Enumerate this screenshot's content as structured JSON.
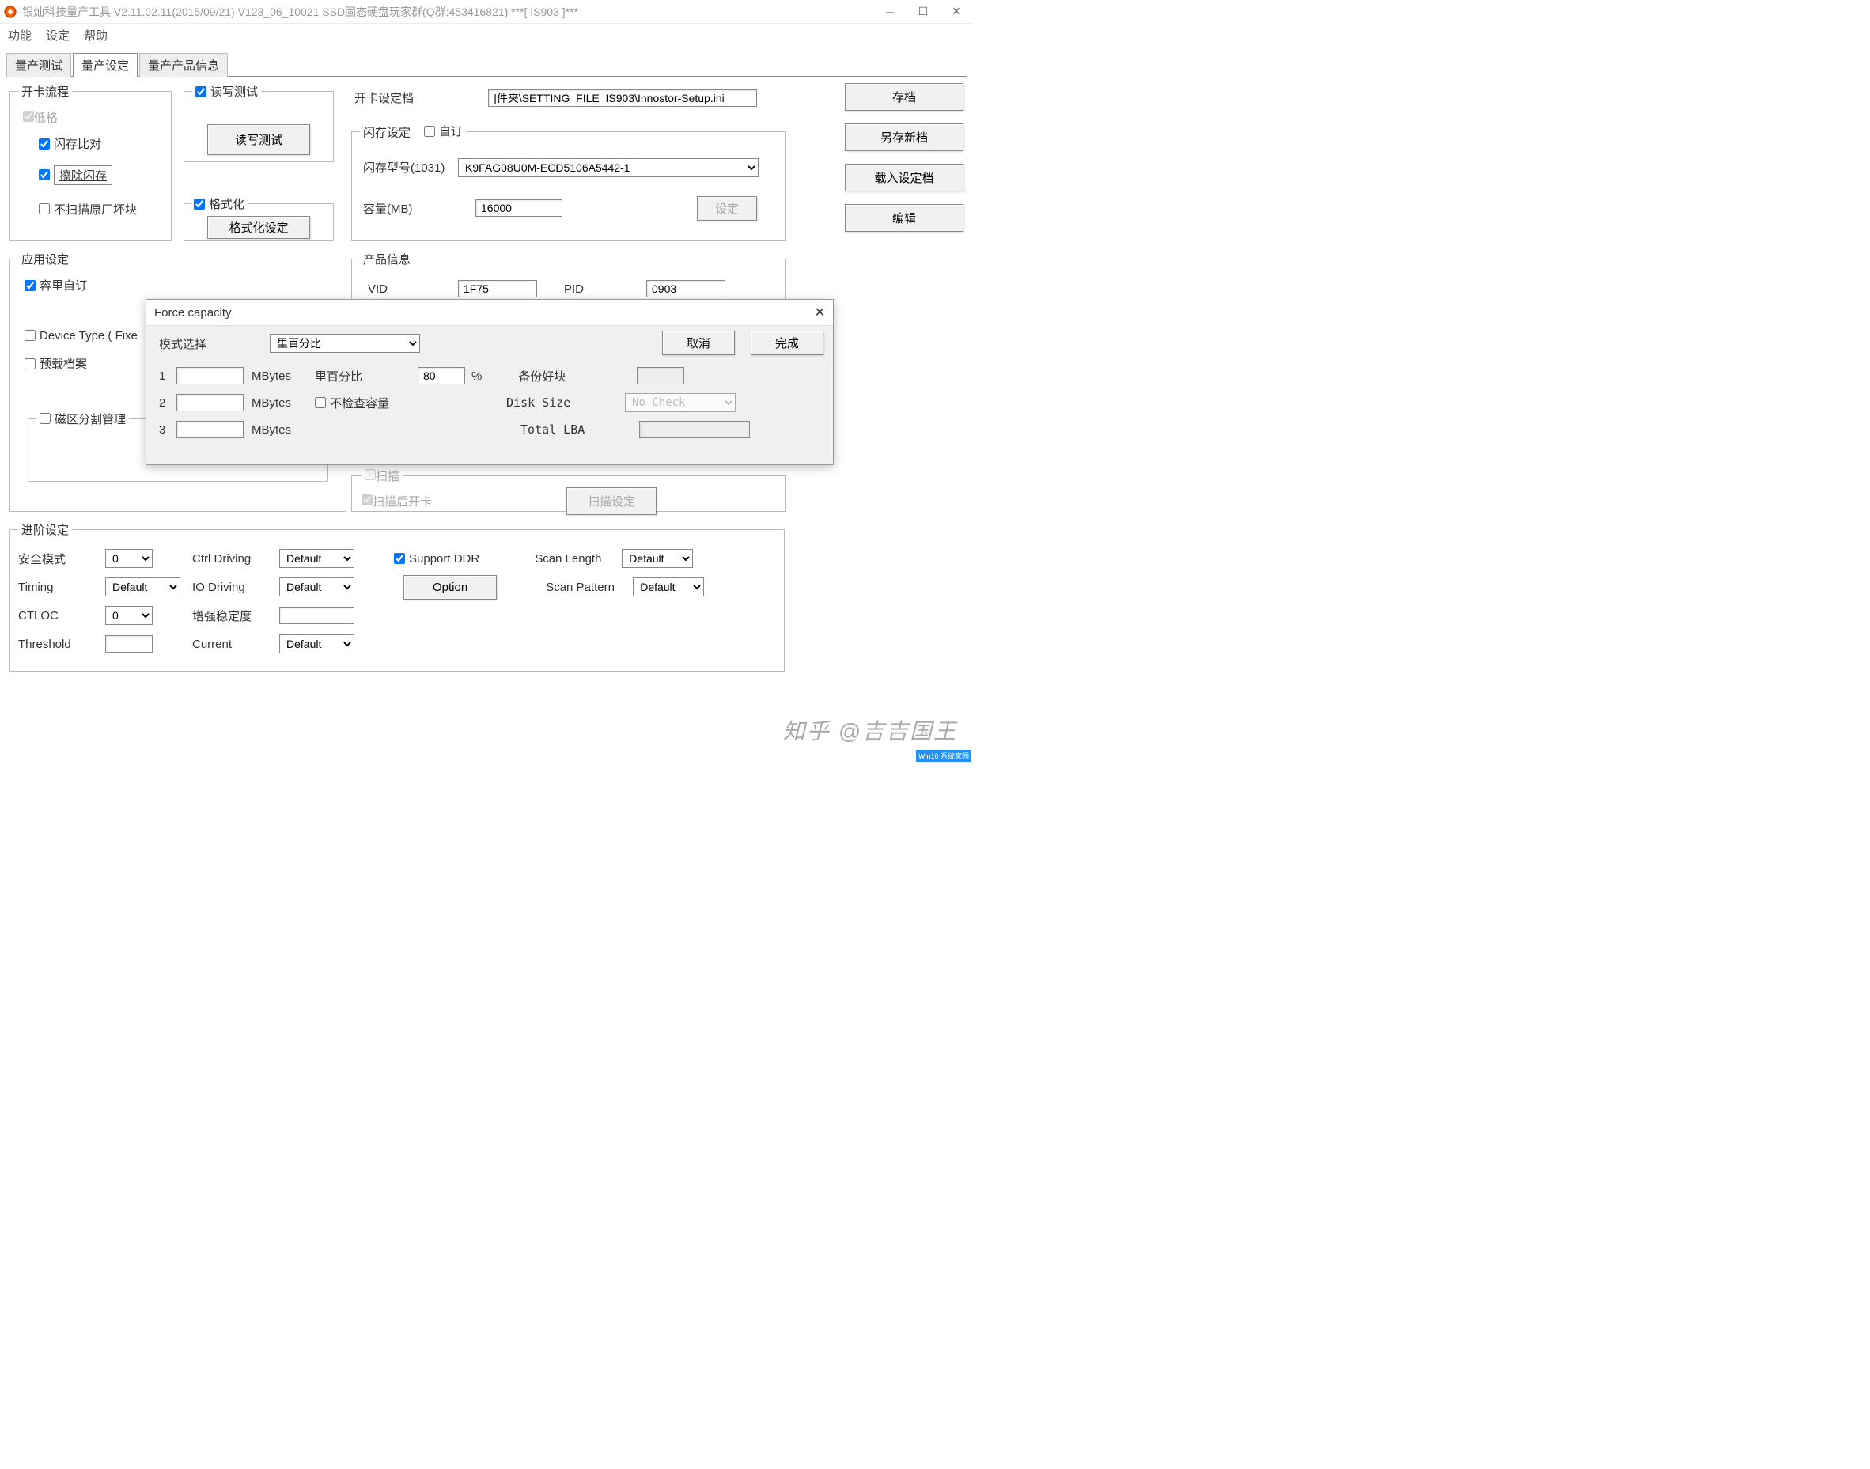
{
  "title": "银灿科技量产工具 V2.11.02.11(2015/09/21) V123_06_10021    SSD固态硬盘玩家群(Q群:453416821)    ***[ IS903 ]***",
  "menu": [
    "功能",
    "设定",
    "帮助"
  ],
  "tabs": [
    "量产测试",
    "量产设定",
    "量产产品信息"
  ],
  "rbtns": [
    "存档",
    "另存新档",
    "载入设定档",
    "编辑"
  ],
  "g_flow": {
    "title": "开卡流程",
    "low": "低格",
    "cmp": "闪存比对",
    "erase": "擦除闪存",
    "noscan": "不扫描原厂坏块"
  },
  "g_rw": {
    "title": "读写测试",
    "btn": "读写测试"
  },
  "g_fmt": {
    "title": "格式化",
    "btn": "格式化设定"
  },
  "g_set": {
    "lbl": "开卡设定档",
    "val": "|件夹\\SETTING_FILE_IS903\\Innostor-Setup.ini"
  },
  "g_flash": {
    "title": "闪存设定",
    "custom": "自订",
    "model_lbl": "闪存型号(1031)",
    "model": "K9FAG08U0M-ECD5106A5442-1",
    "cap_lbl": "容量(MB)",
    "cap": "16000",
    "btn": "设定"
  },
  "g_app": {
    "title": "应用设定",
    "capcust": "容里自订",
    "devtype": "Device Type ( Fixe",
    "preload": "预载档案",
    "part": "磁区分割管理"
  },
  "g_prod": {
    "title": "产品信息",
    "vid_lbl": "VID",
    "vid": "1F75",
    "pid_lbl": "PID",
    "pid": "0903"
  },
  "g_scan": {
    "title": "扫描",
    "after": "扫描后开卡",
    "btn": "扫描设定"
  },
  "g_adv": {
    "title": "进阶设定",
    "row1": {
      "safe_lbl": "安全模式",
      "safe": "0",
      "ctrl_lbl": "Ctrl Driving",
      "ctrl": "Default",
      "ddr": "Support DDR",
      "slen_lbl": "Scan Length",
      "slen": "Default"
    },
    "row2": {
      "timing_lbl": "Timing",
      "timing": "Default",
      "io_lbl": "IO Driving",
      "io": "Default",
      "opt": "Option",
      "spat_lbl": "Scan Pattern",
      "spat": "Default"
    },
    "row3": {
      "ctloc_lbl": "CTLOC",
      "ctloc": "0",
      "stab_lbl": "增强稳定度"
    },
    "row4": {
      "thr_lbl": "Threshold",
      "cur_lbl": "Current",
      "cur": "Default"
    }
  },
  "modal": {
    "title": "Force capacity",
    "mode_lbl": "模式选择",
    "mode": "里百分比",
    "mb": "MBytes",
    "pct_lbl": "里百分比",
    "pct": "80",
    "pct_unit": "%",
    "nochk": "不检查容量",
    "backup_lbl": "备份好块",
    "disk_lbl": "Disk Size",
    "disk": "No Check",
    "lba_lbl": "Total LBA",
    "rows": [
      "1",
      "2",
      "3"
    ],
    "cancel": "取消",
    "done": "完成"
  },
  "watermark": "知乎 @吉吉国王",
  "corner": "Win10 系统家园"
}
